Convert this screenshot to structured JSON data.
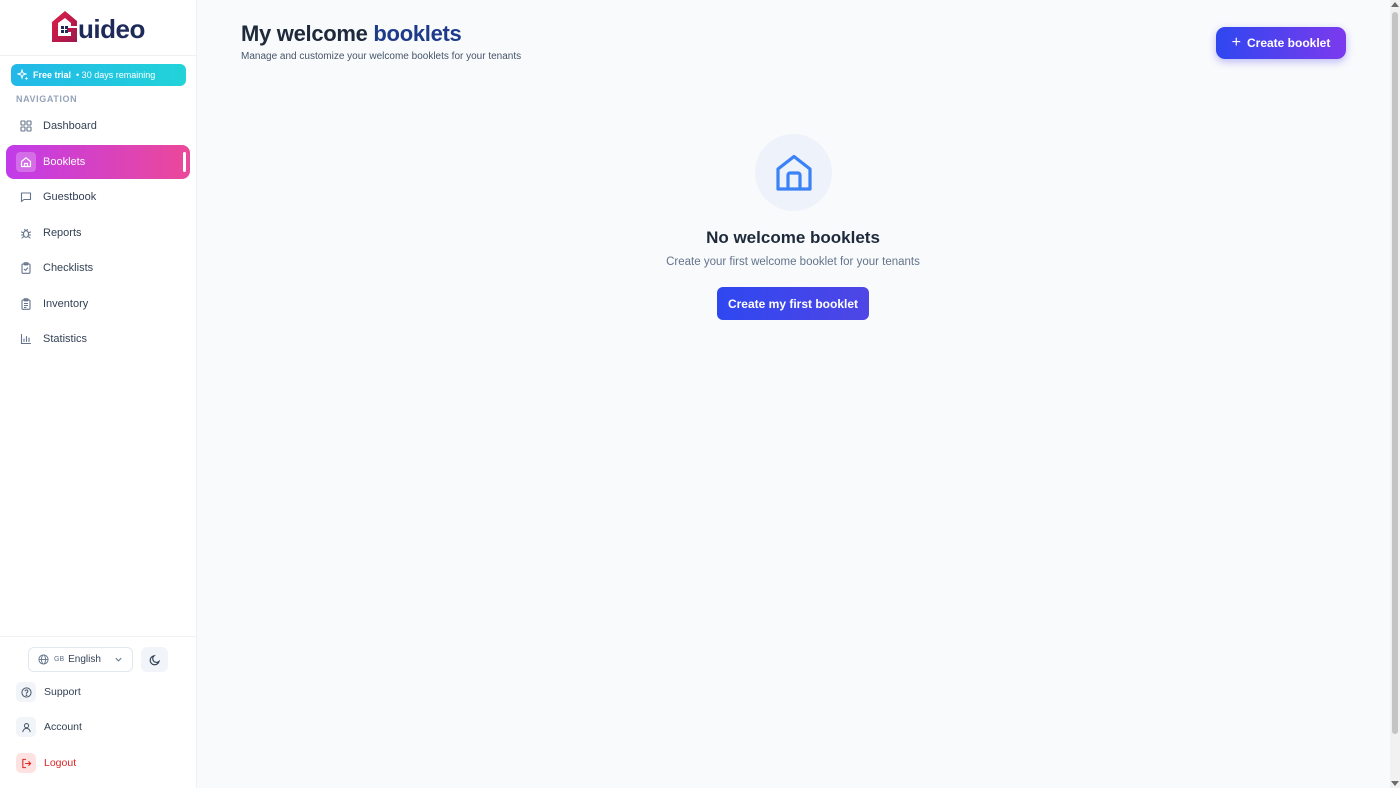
{
  "app": {
    "brand_text": "uideo"
  },
  "trial": {
    "label": "Free trial",
    "remaining": "• 30 days remaining"
  },
  "sidebar": {
    "section_label": "NAVIGATION",
    "items": [
      {
        "label": "Dashboard",
        "icon": "grid-icon"
      },
      {
        "label": "Booklets",
        "icon": "home-icon",
        "active": true
      },
      {
        "label": "Guestbook",
        "icon": "message-icon"
      },
      {
        "label": "Reports",
        "icon": "bug-icon"
      },
      {
        "label": "Checklists",
        "icon": "clipboard-check-icon"
      },
      {
        "label": "Inventory",
        "icon": "clipboard-list-icon"
      },
      {
        "label": "Statistics",
        "icon": "bar-chart-icon"
      }
    ],
    "language": {
      "flag": "GB",
      "label": "English"
    },
    "bottom": [
      {
        "label": "Support",
        "icon": "help-circle-icon"
      },
      {
        "label": "Account",
        "icon": "user-icon"
      },
      {
        "label": "Logout",
        "icon": "logout-icon"
      }
    ]
  },
  "header": {
    "title_prefix": "My welcome",
    "title_accent": "booklets",
    "subtitle": "Manage and customize your welcome booklets for your tenants",
    "create_button": "Create booklet"
  },
  "empty_state": {
    "title": "No welcome booklets",
    "subtitle": "Create your first welcome booklet for your tenants",
    "button": "Create my first booklet"
  },
  "colors": {
    "accent_blue": "#2f47f0",
    "accent_purple": "#7c3aed",
    "active_nav_start": "#c13bea",
    "active_nav_end": "#ec4899",
    "trial_start": "#22b8e8",
    "logout": "#dc2626",
    "logo": "#be185d"
  }
}
